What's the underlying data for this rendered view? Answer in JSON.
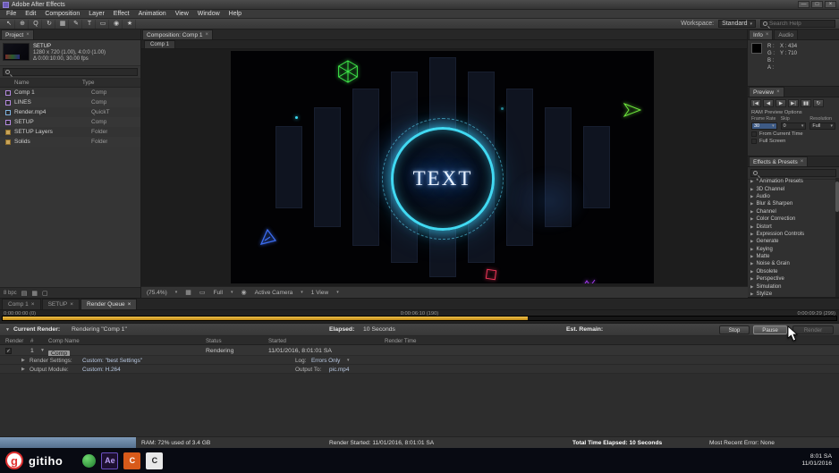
{
  "icons": {
    "close": "×",
    "minimize": "—",
    "maximize": "□",
    "twirl_open": "▼",
    "twirl_closed": "▶",
    "dropdown": "▾",
    "check": "✓"
  },
  "colors": {
    "accent_cyan": "#41d9f2",
    "progress_orange": "#d89b22",
    "brand_red": "#e03131",
    "ram_meter_blue": "#5b7a9d"
  },
  "window": {
    "title": "Adobe After Effects"
  },
  "menu": {
    "items": [
      "File",
      "Edit",
      "Composition",
      "Layer",
      "Effect",
      "Animation",
      "View",
      "Window",
      "Help"
    ]
  },
  "toolbar": {
    "tools": [
      "↖",
      "⊕",
      "Q",
      "↻",
      "▦",
      "✎",
      "T",
      "▭",
      "◉",
      "★"
    ],
    "workspace_label": "Workspace:",
    "workspace_value": "Standard",
    "search_placeholder": "Search Help"
  },
  "project": {
    "tab_label": "Project",
    "selected_name": "SETUP",
    "info_line1": "1280 x 720 (1.00), 4:0:0 (1.00)",
    "info_line2": "Δ 0:00:10:00, 30.00 fps",
    "columns": {
      "name": "Name",
      "type": "Type"
    },
    "items": [
      {
        "name": "Comp 1",
        "type": "Comp"
      },
      {
        "name": "LINES",
        "type": "Comp"
      },
      {
        "name": "Render.mp4",
        "type": "QuickT"
      },
      {
        "name": "SETUP",
        "type": "Comp"
      },
      {
        "name": "SETUP Layers",
        "type": "Folder"
      },
      {
        "name": "Solids",
        "type": "Folder"
      }
    ],
    "footer": {
      "bpc": "8 bpc"
    }
  },
  "composition": {
    "tab_label": "Composition: Comp 1",
    "viewer_tab": "Comp 1",
    "stage_text": "TEXT",
    "controls": {
      "zoom": "(75.4%)",
      "resolution": "Full",
      "camera": "Active Camera",
      "view": "1 View"
    }
  },
  "info_panel": {
    "tab_label": "Info",
    "tab2_label": "Audio",
    "r": "R :",
    "g": "G :",
    "b": "B :",
    "a": "A :",
    "x": "X : 434",
    "y": "Y : 710"
  },
  "preview_panel": {
    "tab_label": "Preview",
    "transport": [
      "|◀",
      "◀",
      "▶",
      "▶|",
      "▮▮",
      "↻"
    ],
    "options_title": "RAM Preview Options",
    "cols": [
      "Frame Rate",
      "Skip",
      "Resolution"
    ],
    "values": [
      "30",
      "0",
      "Full"
    ],
    "from_current_time": "From Current Time",
    "full_screen": "Full Screen"
  },
  "effects_panel": {
    "tab_label": "Effects & Presets",
    "categories": [
      "* Animation Presets",
      "3D Channel",
      "Audio",
      "Blur & Sharpen",
      "Channel",
      "Color Correction",
      "Distort",
      "Expression Controls",
      "Generate",
      "Keying",
      "Matte",
      "Noise & Grain",
      "Obsolete",
      "Perspective",
      "Simulation",
      "Stylize"
    ]
  },
  "render_queue": {
    "tabs": [
      "Comp 1",
      "SETUP",
      "Render Queue"
    ],
    "timeline": {
      "start": "0:00:00:00 (0)",
      "current": "0:00:06:10 (190)",
      "end": "0:00:09:29 (299)",
      "progress_percent": 63
    },
    "current_render": {
      "label": "Current Render:",
      "value": "Rendering \"Comp 1\"",
      "elapsed_label": "Elapsed:",
      "elapsed_value": "10 Seconds",
      "remain_label": "Est. Remain:",
      "stop_button": "Stop",
      "pause_button": "Pause",
      "render_button": "Render"
    },
    "columns": {
      "render": "Render",
      "num": "#",
      "comp_name": "Comp Name",
      "status": "Status",
      "started": "Started",
      "render_time": "Render Time"
    },
    "item": {
      "num": "1",
      "name": "Comp 1",
      "status": "Rendering",
      "started": "11/01/2016, 8:01:01 SA"
    },
    "render_settings": {
      "label": "Render Settings:",
      "value": "Custom: \"best Settings\"",
      "log_label": "Log:",
      "log_value": "Errors Only"
    },
    "output_module": {
      "label": "Output Module:",
      "value": "Custom: H.264",
      "output_label": "Output To:",
      "output_value": "pic.mp4"
    }
  },
  "status_bar": {
    "ram": "RAM: 72% used of 3.4 GB",
    "render_started": "Render Started: 11/01/2016, 8:01:01 SA",
    "total_elapsed": "Total Time Elapsed: 10 Seconds",
    "recent_error": "Most Recent Error: None"
  },
  "taskbar": {
    "brand_initial": "g",
    "brand": "gitiho",
    "ae_label": "Ae",
    "c1_label": "C",
    "c2_label": "C",
    "clock_time": "8:01 SA",
    "clock_date": "11/01/2016"
  }
}
